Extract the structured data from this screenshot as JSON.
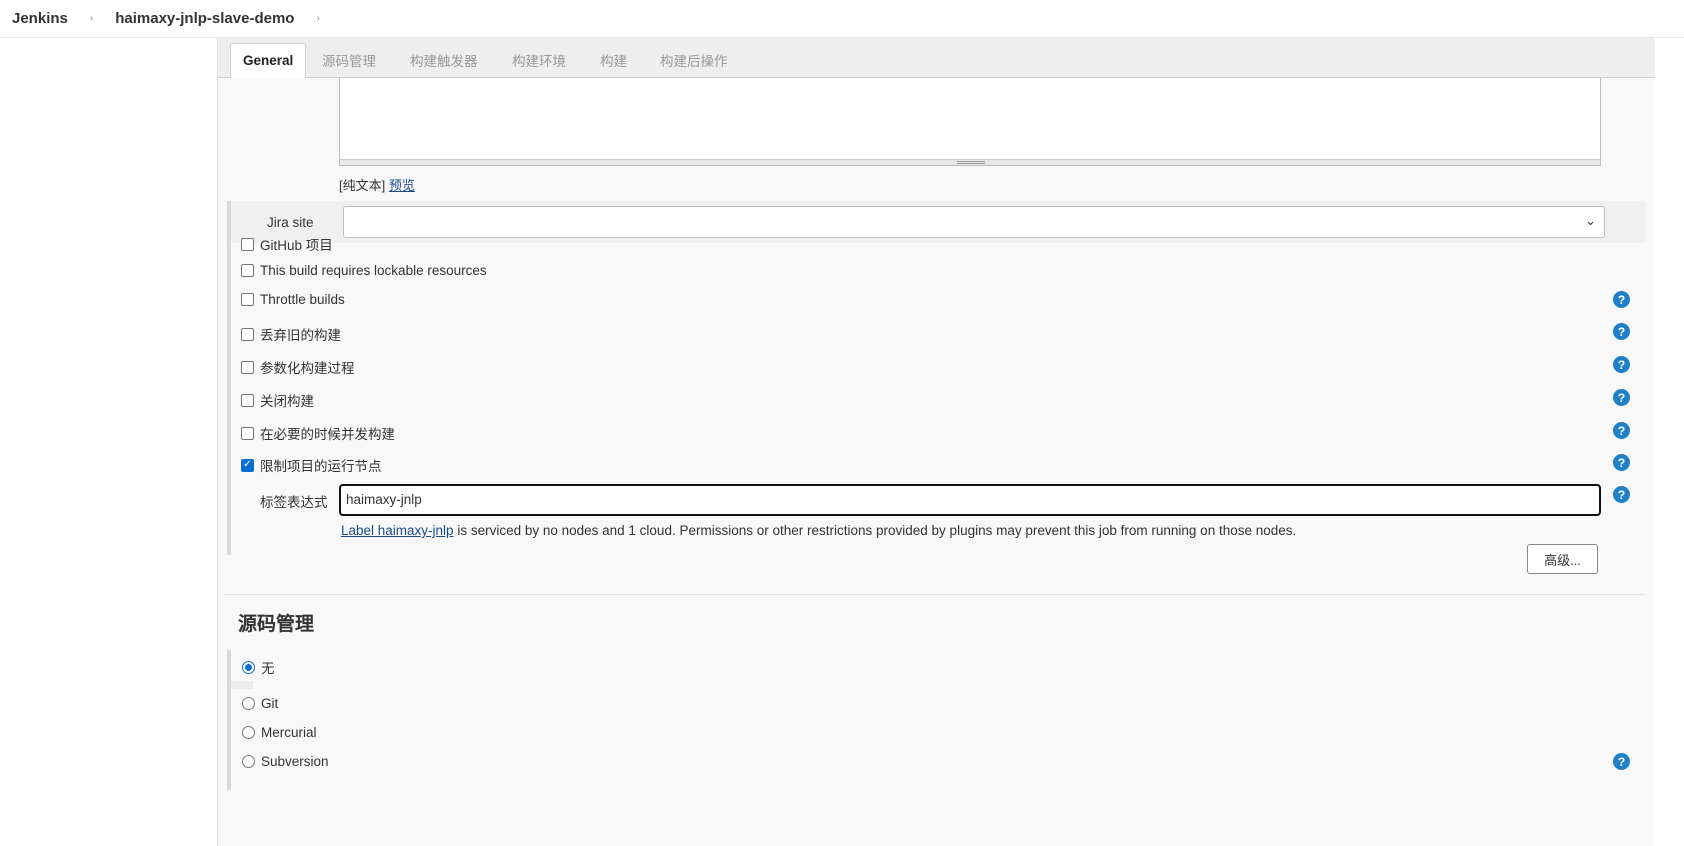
{
  "breadcrumb": {
    "home": "Jenkins",
    "project": "haimaxy-jnlp-slave-demo",
    "separator": "›"
  },
  "tabs": [
    {
      "label": "General",
      "active": true
    },
    {
      "label": "源码管理",
      "active": false
    },
    {
      "label": "构建触发器",
      "active": false
    },
    {
      "label": "构建环境",
      "active": false
    },
    {
      "label": "构建",
      "active": false
    },
    {
      "label": "构建后操作",
      "active": false
    }
  ],
  "description": {
    "mode_text": "[纯文本]",
    "preview_link": "预览"
  },
  "jira": {
    "label": "Jira site",
    "selected": "",
    "chevron": "⌄"
  },
  "options": [
    {
      "label": "GitHub 项目",
      "checked": false,
      "help": false
    },
    {
      "label": "This build requires lockable resources",
      "checked": false,
      "help": false
    },
    {
      "label": "Throttle builds",
      "checked": false,
      "help": true
    },
    {
      "label": "丢弃旧的构建",
      "checked": false,
      "help": true
    },
    {
      "label": "参数化构建过程",
      "checked": false,
      "help": true
    },
    {
      "label": "关闭构建",
      "checked": false,
      "help": true
    },
    {
      "label": "在必要的时候并发构建",
      "checked": false,
      "help": true
    },
    {
      "label": "限制项目的运行节点",
      "checked": true,
      "help": true
    }
  ],
  "label_expression": {
    "label": "标签表达式",
    "value": "haimaxy-jnlp",
    "info_link": "Label haimaxy-jnlp",
    "info_text": " is serviced by no nodes and 1 cloud. Permissions or other restrictions provided by plugins may prevent this job from running on those nodes."
  },
  "advanced_button": "高级...",
  "scm": {
    "title": "源码管理",
    "options": [
      {
        "label": "无",
        "selected": true,
        "help": false
      },
      {
        "label": "Git",
        "selected": false,
        "help": false
      },
      {
        "label": "Mercurial",
        "selected": false,
        "help": false
      },
      {
        "label": "Subversion",
        "selected": false,
        "help": true
      }
    ]
  },
  "help_glyph": "?",
  "check_glyph": "✓",
  "colors": {
    "accent": "#0a6ed1",
    "help": "#1f7fc7",
    "link": "#1a4a8a"
  }
}
